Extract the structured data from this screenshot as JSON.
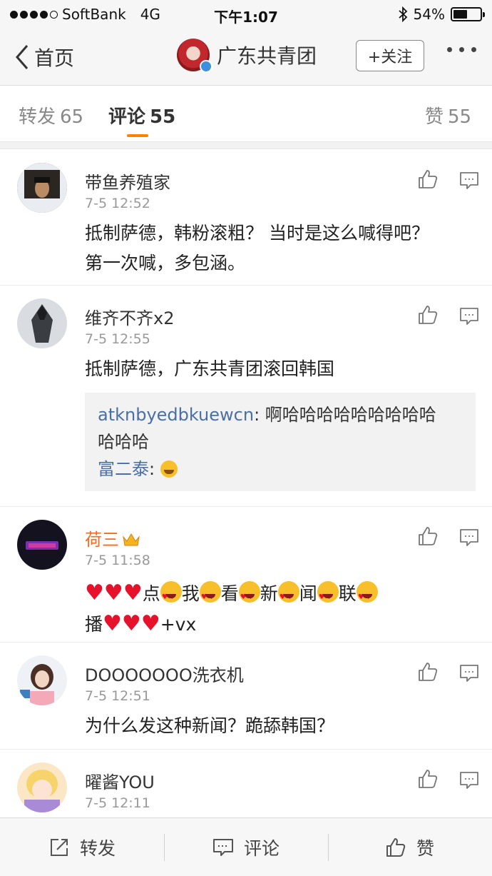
{
  "status_bar": {
    "carrier": "SoftBank",
    "network": "4G",
    "time": "下午1:07",
    "battery": "54%",
    "battery_level": 0.54
  },
  "nav": {
    "back_label": "首页",
    "title": "广东共青团",
    "follow_label": "+关注"
  },
  "tabs": [
    {
      "label": "转发",
      "count": "65"
    },
    {
      "label": "评论",
      "count": "55"
    },
    {
      "label": "赞",
      "count": "55"
    }
  ],
  "comments": [
    {
      "username": "带鱼养殖家",
      "time": "7-5 12:52",
      "text_line1": "抵制萨德，韩粉滚粗？ 当时是这么喊得吧？",
      "text_line2": "第一次喊，多包涵。"
    },
    {
      "username": "维齐不齐x2",
      "time": "7-5 12:55",
      "text": "抵制萨德，广东共青团滚回韩国",
      "replies": [
        {
          "user": "atknbyedbkuewcn",
          "text_line1": ": 啊哈哈哈哈哈哈哈哈哈",
          "text_line2": "哈哈哈"
        },
        {
          "user": "富二泰",
          "text": ": "
        }
      ]
    },
    {
      "username": "荷三",
      "time": "7-5 11:58",
      "chars": [
        "点",
        "我",
        "看",
        "新",
        "闻",
        "联"
      ],
      "line2_start": "播",
      "line2_end": "+vx"
    },
    {
      "username": "DOOOOOOO洗衣机",
      "time": "7-5 12:51",
      "text": "为什么发这种新闻？跪舔韩国？"
    },
    {
      "username": "曜酱YOU",
      "time": "7-5 12:11"
    }
  ],
  "bottom_bar": {
    "repost": "转发",
    "comment": "评论",
    "like": "赞"
  },
  "colors": {
    "accent": "#ff8200",
    "vip_name": "#f86a1f",
    "link": "#4a6fa5"
  }
}
